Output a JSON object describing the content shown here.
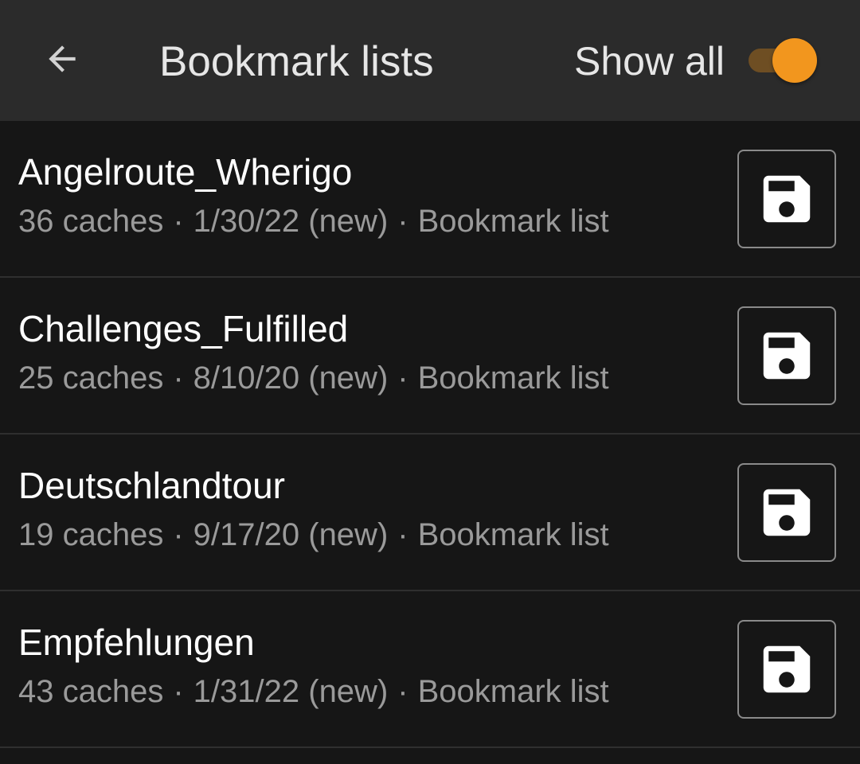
{
  "toolbar": {
    "back_icon": "arrow-left-icon",
    "title": "Bookmark lists",
    "show_all_label": "Show all",
    "show_all_enabled": true,
    "accent_color": "#f2961e"
  },
  "lists": [
    {
      "name": "Angelroute_Wherigo",
      "caches": "36 caches",
      "date": "1/30/22 (new)",
      "type": "Bookmark list",
      "action_icon": "floppy-disk-icon"
    },
    {
      "name": "Challenges_Fulfilled",
      "caches": "25 caches",
      "date": "8/10/20 (new)",
      "type": "Bookmark list",
      "action_icon": "floppy-disk-icon"
    },
    {
      "name": "Deutschlandtour",
      "caches": "19 caches",
      "date": "9/17/20 (new)",
      "type": "Bookmark list",
      "action_icon": "floppy-disk-icon"
    },
    {
      "name": "Empfehlungen",
      "caches": "43 caches",
      "date": "1/31/22 (new)",
      "type": "Bookmark list",
      "action_icon": "floppy-disk-icon"
    }
  ],
  "meta_separator": "·"
}
